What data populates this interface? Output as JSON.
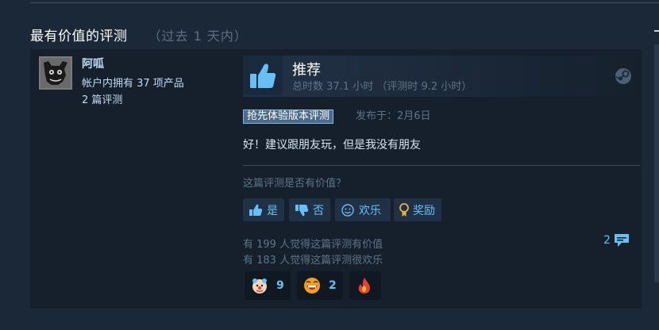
{
  "section": {
    "title": "最有价值的评测",
    "subtitle": "（过去 1 天内）"
  },
  "author": {
    "name": "阿呱",
    "products": "帐户内拥有 37 项产品",
    "reviews": "2 篇评测",
    "avatar_icon": "black-cat-avatar"
  },
  "verdict": {
    "title": "推荐",
    "hours": "总时数 37.1 小时 （评测时 9.2 小时）",
    "icon": "thumbs-up-icon"
  },
  "badge": "抢先体验版本评测",
  "posted": "发布于：2月6日",
  "review_text": "好！建议跟朋友玩，但是我没有朋友",
  "helpful_question": "这篇评测是否有价值？",
  "vote": {
    "yes": "是",
    "no": "否",
    "funny": "欢乐",
    "award": "奖励"
  },
  "stats": {
    "helpful": "有 199 人觉得这篇评测有价值",
    "funny": "有 183 人觉得这篇评测很欢乐"
  },
  "comments": {
    "count": "2"
  },
  "awards": [
    {
      "icon": "clown-face-award-icon",
      "count": "9"
    },
    {
      "icon": "laughing-face-award-icon",
      "count": "2"
    },
    {
      "icon": "flame-award-icon",
      "count": ""
    }
  ],
  "colors": {
    "background": "#1b2838",
    "panel": "#16202d",
    "accent": "#66c0f4",
    "muted": "#5e7488"
  }
}
